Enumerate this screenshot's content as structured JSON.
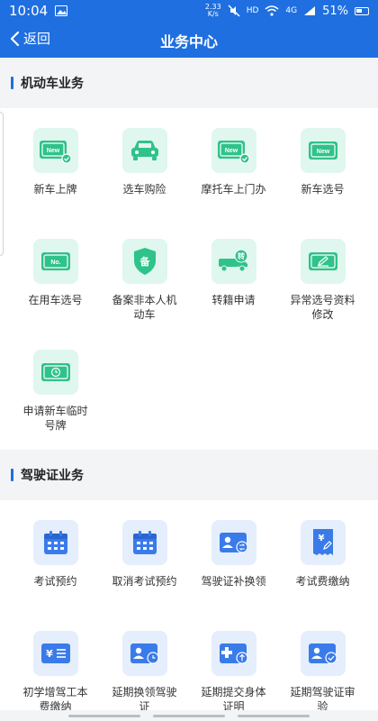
{
  "status": {
    "time": "10:04",
    "net_speed_value": "2.33",
    "net_speed_unit": "K/s",
    "hd": "HD",
    "network": "4G",
    "battery": "51%"
  },
  "nav": {
    "back_label": "返回",
    "title": "业务中心"
  },
  "sections": {
    "motor": {
      "title": "机动车业务",
      "items": [
        {
          "label": "新车上牌",
          "icon": "new-plate-check-icon"
        },
        {
          "label": "选车购险",
          "icon": "car-icon"
        },
        {
          "label": "摩托车上门办",
          "icon": "new-plate-check-icon"
        },
        {
          "label": "新车选号",
          "icon": "new-plate-icon"
        },
        {
          "label": "在用车选号",
          "icon": "no-plate-icon"
        },
        {
          "label": "备案非本人机动车",
          "icon": "shield-icon"
        },
        {
          "label": "转籍申请",
          "icon": "truck-transfer-icon"
        },
        {
          "label": "异常选号资料修改",
          "icon": "plate-edit-icon"
        },
        {
          "label": "申请新车临时号牌",
          "icon": "temporary-plate-icon"
        }
      ]
    },
    "license": {
      "title": "驾驶证业务",
      "items": [
        {
          "label": "考试预约",
          "icon": "calendar-icon"
        },
        {
          "label": "取消考试预约",
          "icon": "calendar-icon"
        },
        {
          "label": "驾驶证补换领",
          "icon": "license-swap-icon"
        },
        {
          "label": "考试费缴纳",
          "icon": "fee-receipt-icon"
        },
        {
          "label": "初学增驾工本费缴纳",
          "icon": "fee-card-icon"
        },
        {
          "label": "延期换领驾驶证",
          "icon": "license-clock-icon"
        },
        {
          "label": "延期提交身体证明",
          "icon": "medical-upload-icon"
        },
        {
          "label": "延期驾驶证审验",
          "icon": "license-check-icon"
        }
      ]
    }
  },
  "colors": {
    "brand": "#1f6fe0",
    "green_icon": "#2fc28a",
    "green_bg": "#dff7ee",
    "blue_icon": "#3a7bea",
    "blue_bg": "#e5eefc"
  }
}
